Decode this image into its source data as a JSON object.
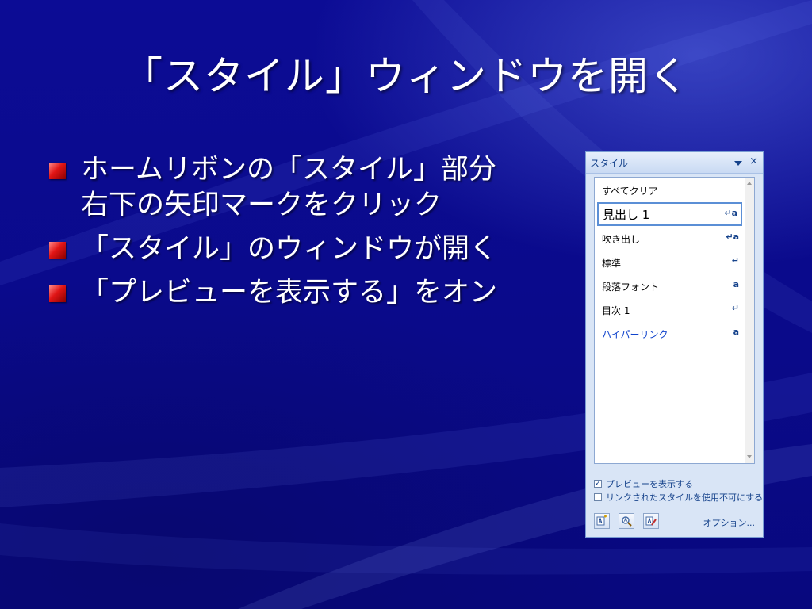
{
  "slide": {
    "title": "「スタイル」ウィンドウを開く",
    "bullets": [
      {
        "line1": "ホームリボンの「スタイル」部分",
        "line2": "右下の矢印マークをクリック"
      },
      {
        "line1": "「スタイル」のウィンドウが開く"
      },
      {
        "line1": "「プレビューを表示する」をオン"
      }
    ]
  },
  "styles_pane": {
    "title": "スタイル",
    "close_glyph": "×",
    "items": [
      {
        "label": "すべてクリア",
        "mark": ""
      },
      {
        "label": "見出し 1",
        "mark": "↵a"
      },
      {
        "label": "吹き出し",
        "mark": "↵a"
      },
      {
        "label": "標準",
        "mark": "↵"
      },
      {
        "label": "段落フォント",
        "mark": "a"
      },
      {
        "label": "目次 1",
        "mark": "↵"
      },
      {
        "label": "ハイパーリンク",
        "mark": "a"
      }
    ],
    "show_preview": {
      "label": "プレビューを表示する",
      "checked": true,
      "check_glyph": "✓"
    },
    "disable_linked": {
      "label": "リンクされたスタイルを使用不可にする",
      "checked": false
    },
    "buttons": [
      {
        "icon": "new-style-icon"
      },
      {
        "icon": "style-inspector-icon"
      },
      {
        "icon": "manage-styles-icon"
      }
    ],
    "options_label": "オプション..."
  },
  "colors": {
    "background": "#0a0a8c",
    "bullet_marker": "#e01515",
    "pane_text": "#15428b",
    "link": "#1144cc"
  }
}
